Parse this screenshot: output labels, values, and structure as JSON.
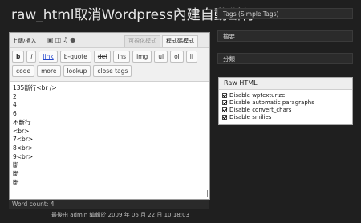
{
  "page": {
    "title": "raw_html取消Wordpress內建自動斷行"
  },
  "editor": {
    "upload_label": "上傳/插入",
    "media_icons": [
      "image-icon",
      "video-icon",
      "audio-icon",
      "media-icon"
    ],
    "tab_visual": "可視化模式",
    "tab_html": "程式碼模式",
    "quicktags_row1": [
      "b",
      "i",
      "link",
      "b-quote",
      "del",
      "ins",
      "img",
      "ul",
      "ol",
      "li"
    ],
    "quicktags_row2": [
      "code",
      "more",
      "lookup",
      "close tags"
    ],
    "content_lines": [
      "135斷行<br />",
      "2",
      "4",
      "6",
      "不斷行",
      "<br>",
      "7<br>",
      "8<br>",
      "9<br>",
      "斷",
      "斷",
      "斷"
    ]
  },
  "status": {
    "word_count_label": "Word count: 4",
    "last_edited": "最後由 admin 編輯於 2009 年 06 月 22 日 10:18:03"
  },
  "sidebar": {
    "tags_label": "Tags (Simple Tags)",
    "box2_label": "摘要",
    "box3_label": "分類",
    "raw_html": {
      "title": "Raw HTML",
      "options": [
        "Disable wptexturize",
        "Disable automatic paragraphs",
        "Disable convert_chars",
        "Disable smilies"
      ],
      "checked": [
        true,
        true,
        true,
        true
      ]
    }
  }
}
